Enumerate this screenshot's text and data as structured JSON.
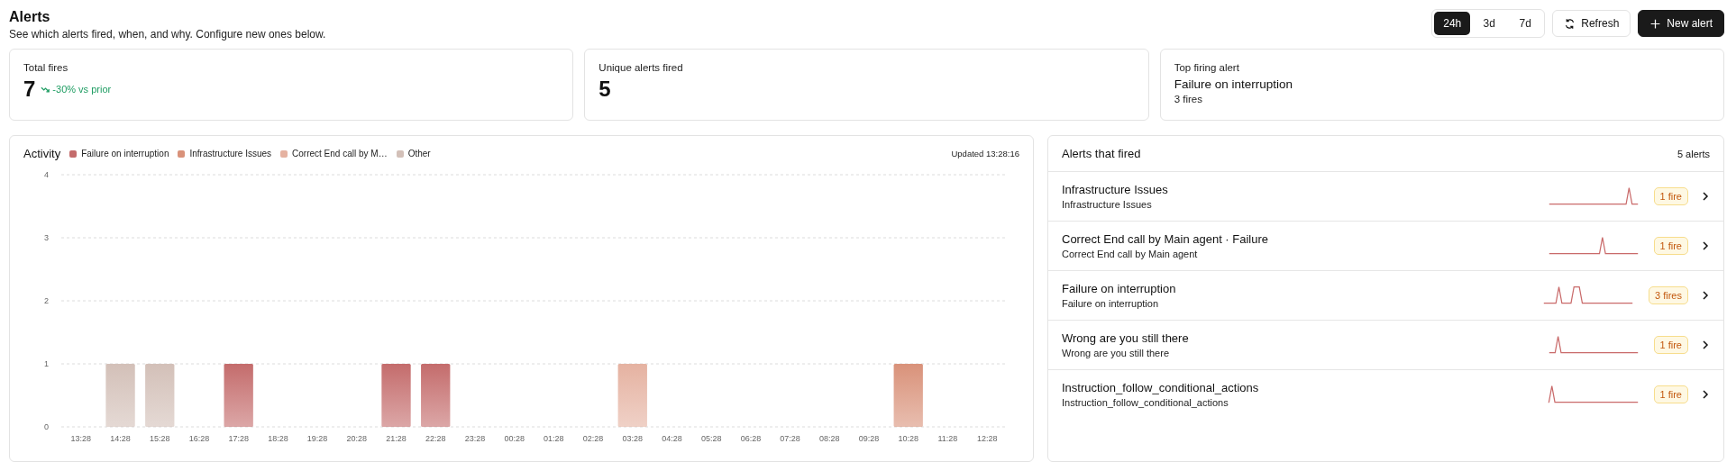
{
  "header": {
    "title": "Alerts",
    "subtitle": "See which alerts fired, when, and why. Configure new ones below."
  },
  "ranges": [
    {
      "label": "24h",
      "selected": true
    },
    {
      "label": "3d",
      "selected": false
    },
    {
      "label": "7d",
      "selected": false
    }
  ],
  "actions": [
    {
      "kind": "refresh",
      "label": "Refresh"
    },
    {
      "kind": "new",
      "label": "New alert"
    }
  ],
  "stats": [
    {
      "label": "Total fires",
      "value": "7",
      "trend": "-30% vs prior"
    },
    {
      "label": "Unique alerts fired",
      "value": "5"
    },
    {
      "label": "Top firing alert",
      "title": "Failure on interruption",
      "detail": "3 fires"
    }
  ],
  "activity": {
    "updated": "Updated 13:28:16",
    "chart_data": {
      "type": "bar",
      "title": "Activity",
      "stacked": true,
      "categories": [
        "13:28",
        "14:28",
        "15:28",
        "16:28",
        "17:28",
        "18:28",
        "19:28",
        "20:28",
        "21:28",
        "22:28",
        "23:28",
        "00:28",
        "01:28",
        "02:28",
        "03:28",
        "04:28",
        "05:28",
        "06:28",
        "07:28",
        "08:28",
        "09:28",
        "10:28",
        "11:28",
        "12:28"
      ],
      "series": [
        {
          "name": "Failure on interruption",
          "color": "#c46c6c",
          "values": [
            0,
            0,
            0,
            0,
            1,
            0,
            0,
            0,
            1,
            1,
            0,
            0,
            0,
            0,
            0,
            0,
            0,
            0,
            0,
            0,
            0,
            0,
            0,
            0
          ]
        },
        {
          "name": "Infrastructure Issues",
          "color": "#d9927a",
          "values": [
            0,
            0,
            0,
            0,
            0,
            0,
            0,
            0,
            0,
            0,
            0,
            0,
            0,
            0,
            0,
            0,
            0,
            0,
            0,
            0,
            0,
            1,
            0,
            0
          ]
        },
        {
          "name": "Correct End call by M…",
          "color": "#e5b2a1",
          "values": [
            0,
            0,
            0,
            0,
            0,
            0,
            0,
            0,
            0,
            0,
            0,
            0,
            0,
            0,
            1,
            0,
            0,
            0,
            0,
            0,
            0,
            0,
            0,
            0
          ]
        },
        {
          "name": "Other",
          "color": "#d3c0b8",
          "values": [
            0,
            1,
            1,
            0,
            0,
            0,
            0,
            0,
            0,
            0,
            0,
            0,
            0,
            0,
            0,
            0,
            0,
            0,
            0,
            0,
            0,
            0,
            0,
            0
          ]
        }
      ],
      "ylim": [
        0,
        4
      ],
      "yticks": [
        0,
        1,
        2,
        3,
        4
      ],
      "grid": true
    }
  },
  "fired": {
    "title": "Alerts that fired",
    "count": "5 alerts",
    "alerts": [
      {
        "name": "Infrastructure Issues",
        "detail": "Infrastructure Issues",
        "fires": "1 fire"
      },
      {
        "name": "Correct End call by Main agent · Failure",
        "detail": "Correct End call by Main agent",
        "fires": "1 fire"
      },
      {
        "name": "Failure on interruption",
        "detail": "Failure on interruption",
        "fires": "3 fires"
      },
      {
        "name": "Wrong are you still there",
        "detail": "Wrong are you still there",
        "fires": "1 fire"
      },
      {
        "name": "Instruction_follow_conditional_actions",
        "detail": "Instruction_follow_conditional_actions",
        "fires": "1 fire"
      }
    ]
  }
}
